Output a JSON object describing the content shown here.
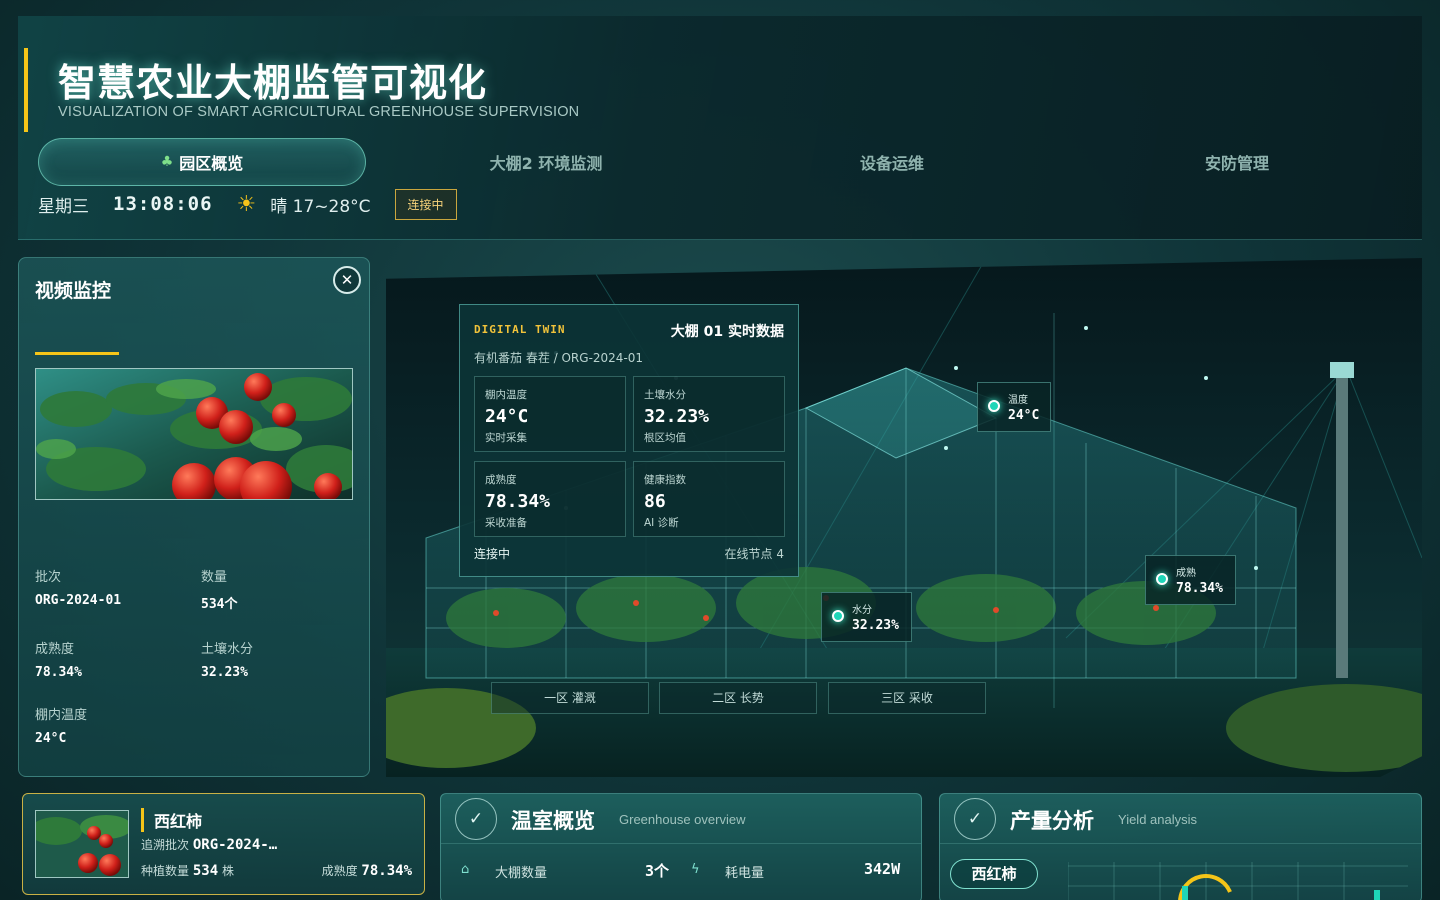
{
  "header": {
    "title": "智慧农业大棚监管可视化",
    "subtitle": "VISUALIZATION OF SMART AGRICULTURAL GREENHOUSE SUPERVISION",
    "tabs": [
      {
        "label": "园区概览",
        "icon": "clover-icon",
        "active": true
      },
      {
        "label": "大棚2 环境监测",
        "active": false
      },
      {
        "label": "设备运维",
        "active": false
      },
      {
        "label": "安防管理",
        "active": false
      }
    ],
    "status": {
      "weekday": "星期三",
      "time": "13:08:06",
      "weather_icon": "sun-icon",
      "weather": "晴 17~28°C",
      "connection": "连接中"
    }
  },
  "video_panel": {
    "title": "视频监控",
    "close_icon": "close-icon",
    "info": [
      {
        "label": "批次",
        "value": "ORG-2024-01"
      },
      {
        "label": "数量",
        "value": "534个"
      },
      {
        "label": "成熟度",
        "value": "78.34%"
      },
      {
        "label": "土壤水分",
        "value": "32.23%"
      },
      {
        "label": "棚内温度",
        "value": "24°C"
      }
    ]
  },
  "digital_twin": {
    "tag": "DIGITAL TWIN",
    "heading": "大棚 01 实时数据",
    "sub": "有机番茄 春茬 / ORG-2024-01",
    "metrics": [
      {
        "label": "棚内温度",
        "value": "24°C",
        "note": "实时采集"
      },
      {
        "label": "土壤水分",
        "value": "32.23%",
        "note": "根区均值"
      },
      {
        "label": "成熟度",
        "value": "78.34%",
        "note": "采收准备"
      },
      {
        "label": "健康指数",
        "value": "86",
        "note": "AI 诊断"
      }
    ],
    "footer_left": "连接中",
    "footer_right": "在线节点 4"
  },
  "scene_chips": [
    {
      "label": "温度",
      "value": "24°C"
    },
    {
      "label": "成熟",
      "value": "78.34%"
    },
    {
      "label": "水分",
      "value": "32.23%"
    }
  ],
  "zones": [
    "一区 灌溉",
    "二区 长势",
    "三区 采收"
  ],
  "crop_card": {
    "name": "西红柿",
    "trace_label": "追溯批次",
    "trace_value": "ORG-2024-…",
    "count_label": "种植数量",
    "count_value": "534",
    "count_unit": "株",
    "ripe_label": "成熟度",
    "ripe_value": "78.34%"
  },
  "greenhouse_overview": {
    "title": "温室概览",
    "title_en": "Greenhouse overview",
    "check_icon": "check-icon",
    "rows": [
      {
        "icon": "home-icon",
        "label": "大棚数量",
        "value": "3个"
      },
      {
        "icon": "bolt-icon",
        "label": "耗电量",
        "value": "342W"
      }
    ]
  },
  "yield_analysis": {
    "title": "产量分析",
    "title_en": "Yield analysis",
    "check_icon": "check-icon",
    "selected_crop": "西红柿"
  },
  "colors": {
    "accent_yellow": "#f5c518",
    "accent_teal": "#1ed6b8",
    "panel_bg": "#1a5a5c"
  }
}
